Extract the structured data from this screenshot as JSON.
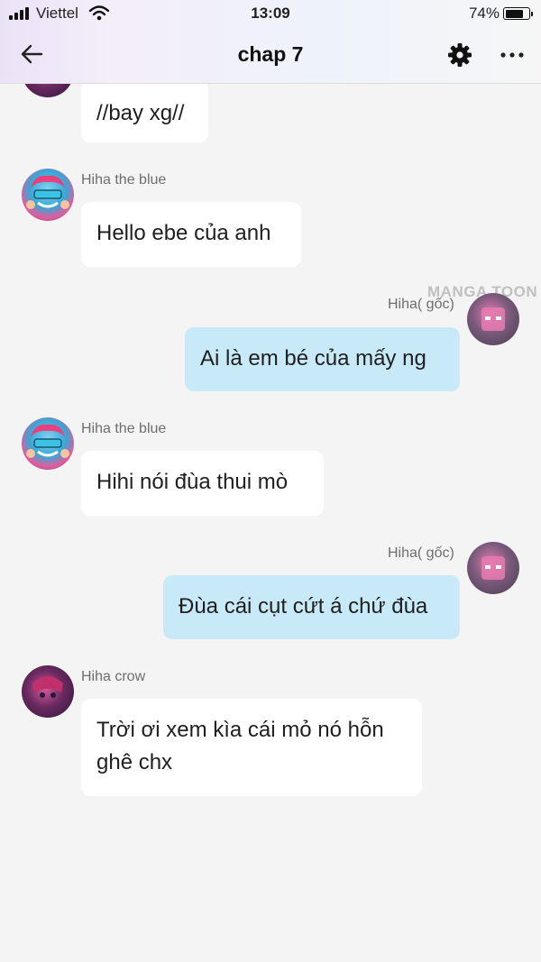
{
  "status_bar": {
    "carrier": "Viettel",
    "time": "13:09",
    "battery": "74%",
    "battery_level": 0.74
  },
  "header": {
    "title": "chap 7",
    "back_icon": "arrow-left-icon",
    "settings_icon": "gear-icon",
    "more_icon": "more-horizontal-icon"
  },
  "watermark": "MANGA TOON",
  "messages": [
    {
      "sender": "",
      "text": "//bay xg//",
      "direction": "incoming"
    },
    {
      "sender": "Hiha the blue",
      "text": "Hello ebe của anh",
      "direction": "incoming"
    },
    {
      "sender": "Hiha( gốc)",
      "text": "Ai là em bé của mấy ng",
      "direction": "outgoing"
    },
    {
      "sender": "Hiha the blue",
      "text": "Hihi nói đùa thui mò",
      "direction": "incoming"
    },
    {
      "sender": "Hiha( gốc)",
      "text": "Đùa cái cụt cứt á chứ đùa",
      "direction": "outgoing"
    },
    {
      "sender": "Hiha crow",
      "text": "Trời ơi xem kìa cái mỏ nó hỗn ghê chx",
      "direction": "incoming"
    }
  ],
  "colors": {
    "incoming_bubble": "#ffffff",
    "outgoing_bubble": "#c8eaf8",
    "background": "#f4f4f4"
  }
}
